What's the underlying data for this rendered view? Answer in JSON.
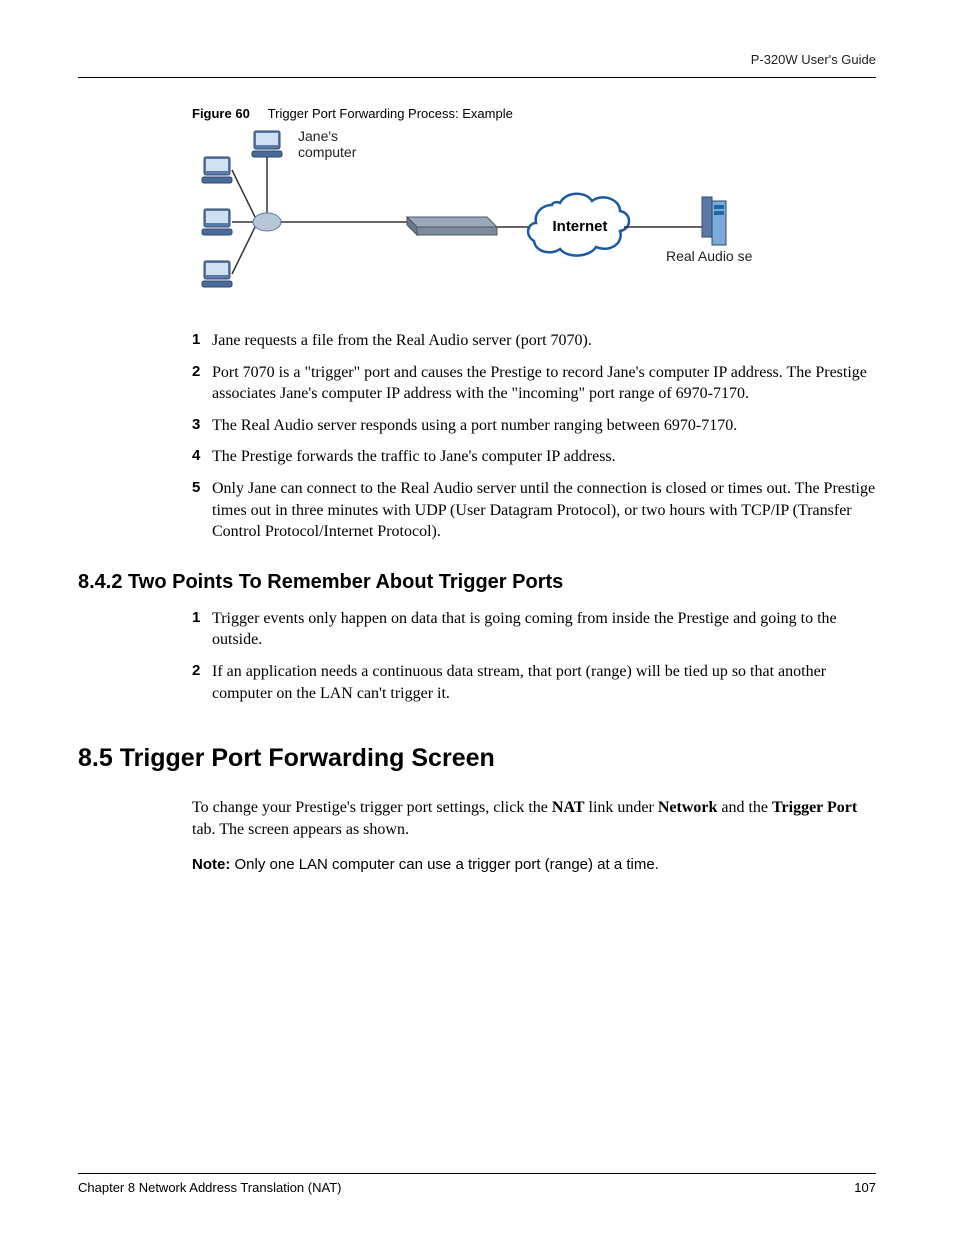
{
  "header": {
    "doc_title": "P-320W User's Guide"
  },
  "figure": {
    "label": "Figure 60",
    "caption": "Trigger Port Forwarding Process: Example",
    "labels": {
      "janes_computer_l1": "Jane's",
      "janes_computer_l2": "computer",
      "internet": "Internet",
      "server": "Real Audio server"
    }
  },
  "steps_process": [
    "Jane requests a file from the Real Audio server (port 7070).",
    "Port 7070 is a \"trigger\" port and causes the Prestige to record Jane's computer IP address. The Prestige associates Jane's computer IP address with the \"incoming\" port range of 6970-7170.",
    "The Real Audio server responds using a port number ranging between 6970-7170.",
    "The Prestige forwards the traffic to Jane's computer IP address.",
    "Only Jane can connect to the Real Audio server until the connection is closed or times out. The Prestige times out in three minutes with UDP (User Datagram Protocol), or two hours with TCP/IP (Transfer Control Protocol/Internet Protocol)."
  ],
  "section_842": {
    "heading": "8.4.2  Two Points To Remember About Trigger Ports",
    "points": [
      "Trigger events only happen on data that is going coming from inside the Prestige and going to the outside.",
      "If an application needs a continuous data stream, that port (range) will be tied up so that another computer on the LAN can't trigger it."
    ]
  },
  "section_85": {
    "heading": "8.5  Trigger Port Forwarding Screen",
    "para_pre": "To change your Prestige's trigger port settings, click the ",
    "para_nat": "NAT",
    "para_mid": " link under ",
    "para_network": "Network",
    "para_post1": " and the ",
    "para_trigger": "Trigger Port",
    "para_post2": " tab. The screen appears as shown.",
    "note_label": "Note:",
    "note_text": " Only one LAN computer can use a trigger port (range) at a time."
  },
  "footer": {
    "chapter": "Chapter 8 Network Address Translation (NAT)",
    "page": "107"
  }
}
